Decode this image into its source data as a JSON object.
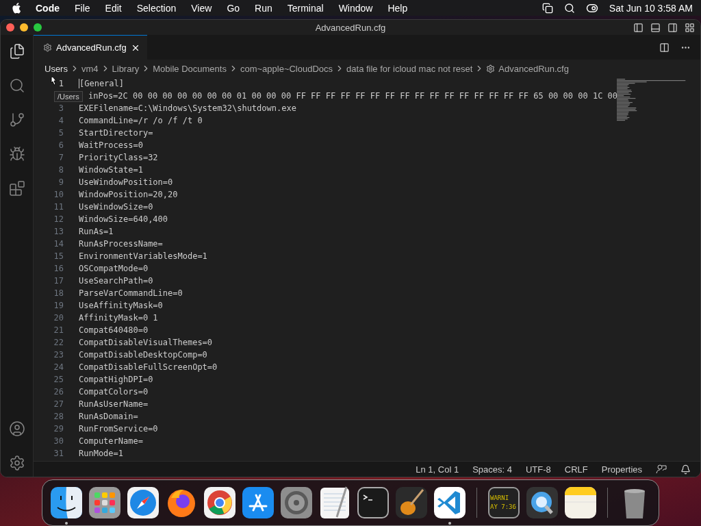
{
  "menu_bar": {
    "app": "Code",
    "items": [
      "File",
      "Edit",
      "Selection",
      "View",
      "Go",
      "Run",
      "Terminal",
      "Window",
      "Help"
    ],
    "clock": "Sat Jun 10  3:58 AM"
  },
  "window": {
    "title": "AdvancedRun.cfg"
  },
  "activity_bar": [
    {
      "kind": "files",
      "selected": true
    },
    {
      "kind": "search",
      "selected": false
    },
    {
      "kind": "source-control",
      "selected": false
    },
    {
      "kind": "run",
      "selected": false
    },
    {
      "kind": "extensions",
      "selected": false
    }
  ],
  "tabs": [
    {
      "label": "AdvancedRun.cfg",
      "selected": true
    }
  ],
  "breadcrumbs": [
    "Users",
    "vm4",
    "Library",
    "Mobile Documents",
    "com~apple~CloudDocs",
    "data file for icloud mac not reset",
    "AdvancedRun.cfg"
  ],
  "tooltip": "/Users",
  "lines": [
    {
      "number": "1",
      "text": "[General]"
    },
    {
      "text": "inPos=2C 00 00 00 00 00 00 00 01 00 00 00 FF FF FF FF FF FF FF FF FF FF FF FF FF FF FF FF 65 00 00 00 1C 00"
    },
    {
      "number": "3",
      "text": "EXEFilename=C:\\Windows\\System32\\shutdown.exe"
    },
    {
      "number": "4",
      "text": "CommandLine=/r /o /f /t 0"
    },
    {
      "number": "5",
      "text": "StartDirectory="
    },
    {
      "number": "6",
      "text": "WaitProcess=0"
    },
    {
      "number": "7",
      "text": "PriorityClass=32"
    },
    {
      "number": "8",
      "text": "WindowState=1"
    },
    {
      "number": "9",
      "text": "UseWindowPosition=0"
    },
    {
      "number": "10",
      "text": "WindowPosition=20,20"
    },
    {
      "number": "11",
      "text": "UseWindowSize=0"
    },
    {
      "number": "12",
      "text": "WindowSize=640,400"
    },
    {
      "number": "13",
      "text": "RunAs=1"
    },
    {
      "number": "14",
      "text": "RunAsProcessName="
    },
    {
      "number": "15",
      "text": "EnvironmentVariablesMode=1"
    },
    {
      "number": "16",
      "text": "OSCompatMode=0"
    },
    {
      "number": "17",
      "text": "UseSearchPath=0"
    },
    {
      "number": "18",
      "text": "ParseVarCommandLine=0"
    },
    {
      "number": "19",
      "text": "UseAffinityMask=0"
    },
    {
      "number": "20",
      "text": "AffinityMask=0 1"
    },
    {
      "number": "21",
      "text": "Compat640480=0"
    },
    {
      "number": "22",
      "text": "CompatDisableVisualThemes=0"
    },
    {
      "number": "23",
      "text": "CompatDisableDesktopComp=0"
    },
    {
      "number": "24",
      "text": "CompatDisableFullScreenOpt=0"
    },
    {
      "number": "25",
      "text": "CompatHighDPI=0"
    },
    {
      "number": "26",
      "text": "CompatColors=0"
    },
    {
      "number": "27",
      "text": "RunAsUserName="
    },
    {
      "number": "28",
      "text": "RunAsDomain="
    },
    {
      "number": "29",
      "text": "RunFromService=0"
    },
    {
      "number": "30",
      "text": "ComputerName="
    },
    {
      "number": "31",
      "text": "RunMode=1"
    }
  ],
  "status_bar": [
    "Ln 1, Col 1",
    "Spaces: 4",
    "UTF-8",
    "CRLF",
    "Properties"
  ],
  "dock": [
    {
      "kind": "finder",
      "running": true
    },
    {
      "kind": "launchpad",
      "running": false
    },
    {
      "kind": "safari",
      "running": false
    },
    {
      "kind": "firefox",
      "running": false
    },
    {
      "kind": "chrome",
      "running": false
    },
    {
      "kind": "appstore",
      "running": false
    },
    {
      "kind": "settings",
      "running": false
    },
    {
      "kind": "textedit",
      "running": false
    },
    {
      "kind": "terminal",
      "running": false
    },
    {
      "kind": "garageband",
      "running": false
    },
    {
      "kind": "vscode",
      "running": true
    },
    {
      "kind": "separator"
    },
    {
      "kind": "console",
      "running": false,
      "lines": [
        "WARNI",
        "AY 7:36"
      ]
    },
    {
      "kind": "quicktime",
      "running": false
    },
    {
      "kind": "notes",
      "running": false
    },
    {
      "kind": "separator"
    },
    {
      "kind": "trash",
      "running": false
    }
  ]
}
